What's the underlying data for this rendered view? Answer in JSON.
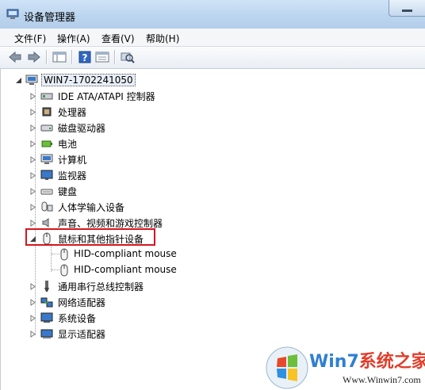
{
  "window": {
    "title": "设备管理器"
  },
  "menu": [
    {
      "label": "文件(F)"
    },
    {
      "label": "操作(A)"
    },
    {
      "label": "查看(V)"
    },
    {
      "label": "帮助(H)"
    }
  ],
  "tree": {
    "root": {
      "label": "WIN7-1702241050",
      "expanded": true
    },
    "categories": [
      {
        "label": "IDE ATA/ATAPI 控制器",
        "icon": "ide-controller-icon",
        "expanded": false
      },
      {
        "label": "处理器",
        "icon": "processor-icon",
        "expanded": false
      },
      {
        "label": "磁盘驱动器",
        "icon": "disk-drive-icon",
        "expanded": false
      },
      {
        "label": "电池",
        "icon": "battery-icon",
        "expanded": false
      },
      {
        "label": "计算机",
        "icon": "computer-icon",
        "expanded": false
      },
      {
        "label": "监视器",
        "icon": "monitor-icon",
        "expanded": false
      },
      {
        "label": "键盘",
        "icon": "keyboard-icon",
        "expanded": false
      },
      {
        "label": "人体学输入设备",
        "icon": "hid-icon",
        "expanded": false
      },
      {
        "label": "声音、视频和游戏控制器",
        "icon": "sound-icon",
        "expanded": false
      },
      {
        "label": "鼠标和其他指针设备",
        "icon": "mouse-icon",
        "expanded": true,
        "children": [
          {
            "label": "HID-compliant mouse",
            "icon": "mouse-icon"
          },
          {
            "label": "HID-compliant mouse",
            "icon": "mouse-icon"
          }
        ]
      },
      {
        "label": "通用串行总线控制器",
        "icon": "usb-icon",
        "expanded": false
      },
      {
        "label": "网络适配器",
        "icon": "network-icon",
        "expanded": false
      },
      {
        "label": "系统设备",
        "icon": "system-device-icon",
        "expanded": false
      },
      {
        "label": "显示适配器",
        "icon": "display-adapter-icon",
        "expanded": false
      }
    ]
  },
  "watermark": {
    "brand_prefix": "Win7",
    "brand_suffix": "系统之家",
    "url": "Www.Winwin7.com"
  },
  "colors": {
    "highlight": "#d4161f",
    "titlebar": "#c3d9f1"
  }
}
